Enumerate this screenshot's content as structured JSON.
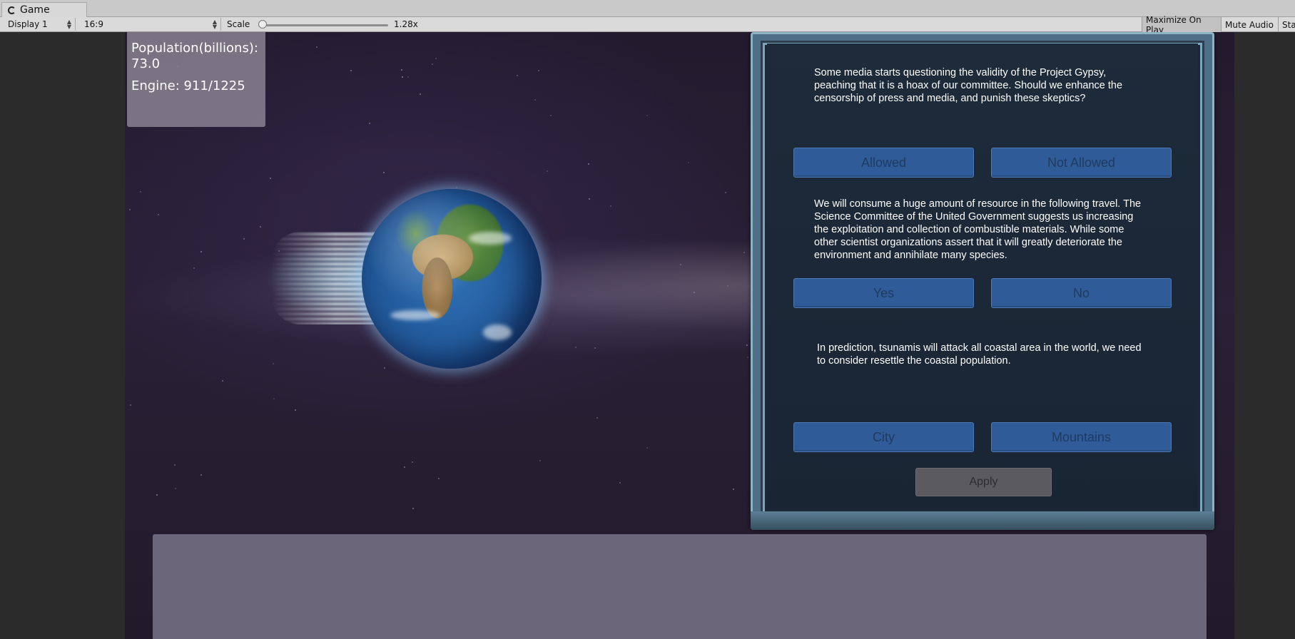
{
  "window": {
    "tab_title": "Game"
  },
  "toolbar": {
    "display": "Display 1",
    "aspect": "16:9",
    "scale_label": "Scale",
    "scale_value": "1.28x",
    "scale_fraction": 0.02,
    "maximize_on_play": "Maximize On Play",
    "mute_audio": "Mute Audio",
    "stats": "Stats"
  },
  "hud": {
    "population_label": "Population(billions):",
    "population_value": "73.0",
    "engine_text": "Engine: 911/1225"
  },
  "events": [
    {
      "question": "Some media starts questioning the validity of the Project Gypsy, peaching that it is a hoax of our committee. Should we enhance the censorship of press and media, and punish these skeptics?",
      "options": [
        "Allowed",
        "Not Allowed"
      ]
    },
    {
      "question": "We will consume a huge amount of resource in the following travel. The Science Committee of the United Government suggests us increasing the exploitation and collection of combustible materials. While some other scientist organizations assert that it will greatly deteriorate the environment and annihilate many species.",
      "options": [
        "Yes",
        "No"
      ]
    },
    {
      "question": "In prediction, tsunamis will attack all coastal area in the world, we need to consider resettle the coastal population.",
      "options": [
        "City",
        "Mountains"
      ]
    }
  ],
  "apply_label": "Apply",
  "colors": {
    "option_button": "#2f5c99",
    "panel_background": "#1c2838",
    "frame": "#4e6f86",
    "hud_panel": "#918c9b"
  }
}
